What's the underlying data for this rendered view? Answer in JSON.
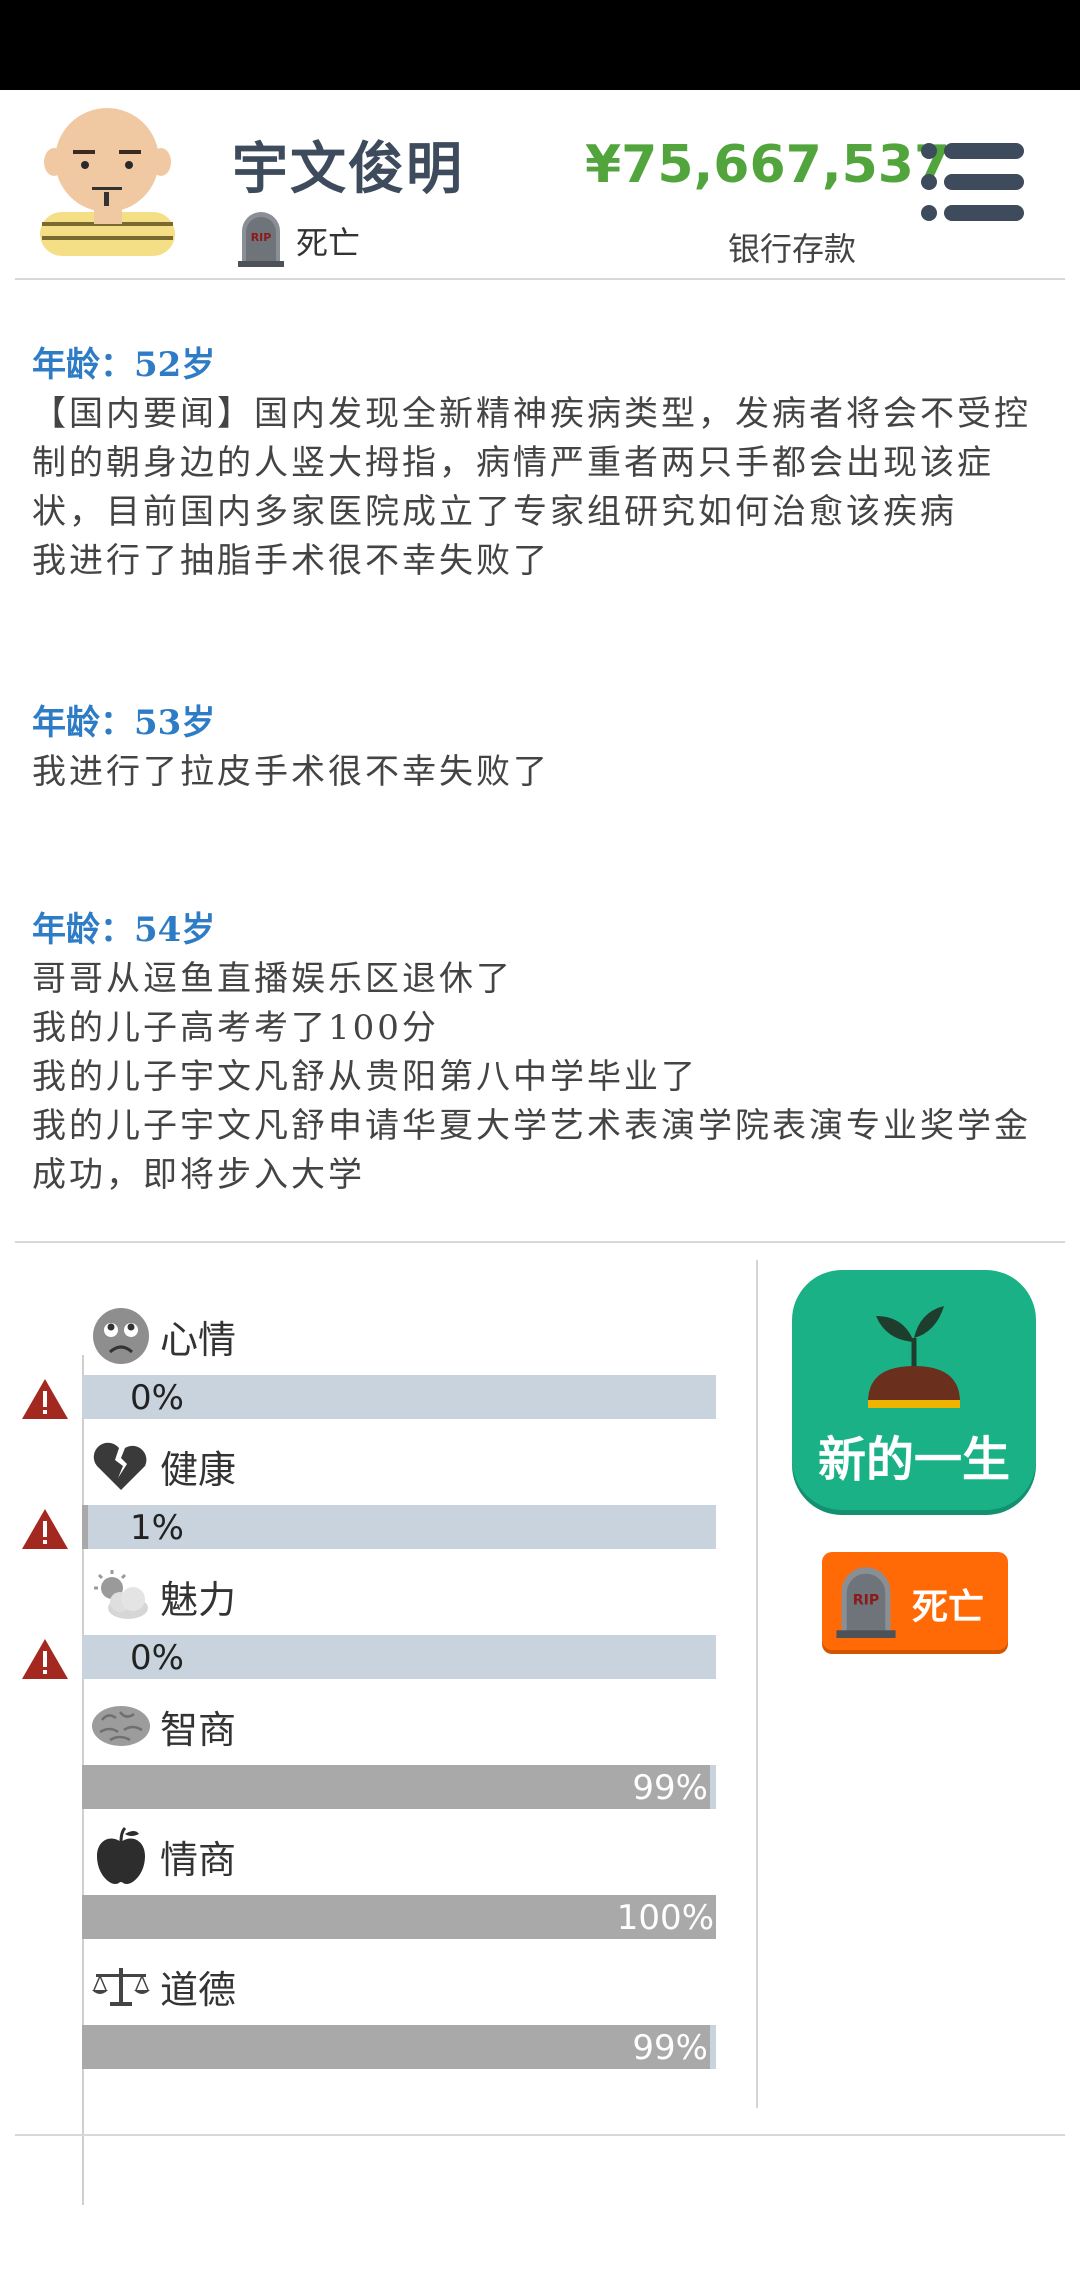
{
  "player": {
    "name": "宇文俊明",
    "status": "死亡",
    "money": "¥75,667,537",
    "money_label": "银行存款"
  },
  "log": [
    {
      "age": "年龄：52岁",
      "lines": [
        "【国内要闻】国内发现全新精神疾病类型，发病者将会不受控制的朝身边的人竖大拇指，病情严重者两只手都会出现该症状，目前国内多家医院成立了专家组研究如何治愈该疾病",
        "我进行了抽脂手术很不幸失败了"
      ]
    },
    {
      "age": "年龄：53岁",
      "lines": [
        "我进行了拉皮手术很不幸失败了"
      ]
    },
    {
      "age": "年龄：54岁",
      "lines": [
        "哥哥从逗鱼直播娱乐区退休了",
        "我的儿子高考考了100分",
        "我的儿子宇文凡舒从贵阳第八中学毕业了",
        "我的儿子宇文凡舒申请华夏大学艺术表演学院表演专业奖学金成功，即将步入大学"
      ]
    }
  ],
  "stats": [
    {
      "label": "心情",
      "value": "0%",
      "percent": 0,
      "icon": "sad-face-icon",
      "warning": true
    },
    {
      "label": "健康",
      "value": "1%",
      "percent": 1,
      "icon": "broken-heart-icon",
      "warning": true
    },
    {
      "label": "魅力",
      "value": "0%",
      "percent": 0,
      "icon": "cloudy-sun-icon",
      "warning": true
    },
    {
      "label": "智商",
      "value": "99%",
      "percent": 99,
      "icon": "brain-icon",
      "warning": false
    },
    {
      "label": "情商",
      "value": "100%",
      "percent": 100,
      "icon": "apple-icon",
      "warning": false
    },
    {
      "label": "道德",
      "value": "99%",
      "percent": 99,
      "icon": "scales-icon",
      "warning": false
    }
  ],
  "actions": {
    "new_life": "新的一生",
    "dead": "死亡"
  },
  "colors": {
    "name": "#3d4b5c",
    "money": "#52a53c",
    "age": "#2f7cc6",
    "new_life_bg": "#1bb186",
    "dead_bg": "#ff6a06",
    "bar_low_bg": "#c8d3de",
    "bar_high_fill": "#a9a9a9"
  }
}
